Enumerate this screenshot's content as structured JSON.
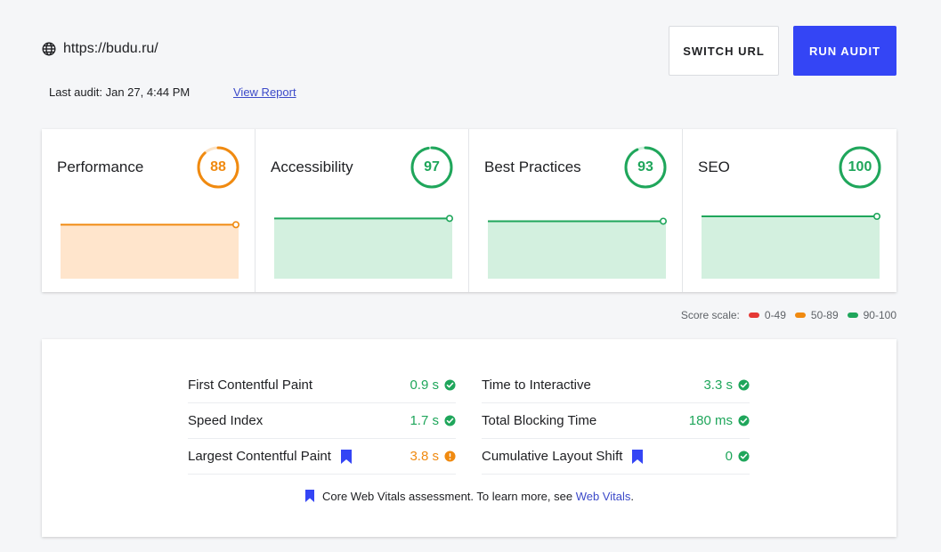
{
  "header": {
    "url": "https://budu.ru/",
    "last_audit": "Last audit: Jan 27, 4:44 PM",
    "view_report": "View Report",
    "switch_url": "SWITCH URL",
    "run_audit": "RUN AUDIT"
  },
  "colors": {
    "good": "#1fa65b",
    "average": "#f08a10",
    "poor": "#e53935",
    "primary": "#3445f5"
  },
  "scores": [
    {
      "title": "Performance",
      "score": "88",
      "status": "average"
    },
    {
      "title": "Accessibility",
      "score": "97",
      "status": "good"
    },
    {
      "title": "Best Practices",
      "score": "93",
      "status": "good"
    },
    {
      "title": "SEO",
      "score": "100",
      "status": "good"
    }
  ],
  "legend": {
    "label": "Score scale:",
    "items": [
      {
        "label": "0-49",
        "color": "#e53935"
      },
      {
        "label": "50-89",
        "color": "#f08a10"
      },
      {
        "label": "90-100",
        "color": "#1fa65b"
      }
    ]
  },
  "metrics": [
    {
      "name": "First Contentful Paint",
      "value": "0.9 s",
      "status": "good",
      "cwv": false
    },
    {
      "name": "Time to Interactive",
      "value": "3.3 s",
      "status": "good",
      "cwv": false
    },
    {
      "name": "Speed Index",
      "value": "1.7 s",
      "status": "good",
      "cwv": false
    },
    {
      "name": "Total Blocking Time",
      "value": "180 ms",
      "status": "good",
      "cwv": false
    },
    {
      "name": "Largest Contentful Paint",
      "value": "3.8 s",
      "status": "average",
      "cwv": true
    },
    {
      "name": "Cumulative Layout Shift",
      "value": "0",
      "status": "good",
      "cwv": true
    }
  ],
  "footnote": {
    "text": "Core Web Vitals assessment. To learn more, see",
    "link": "Web Vitals",
    "suffix": "."
  }
}
